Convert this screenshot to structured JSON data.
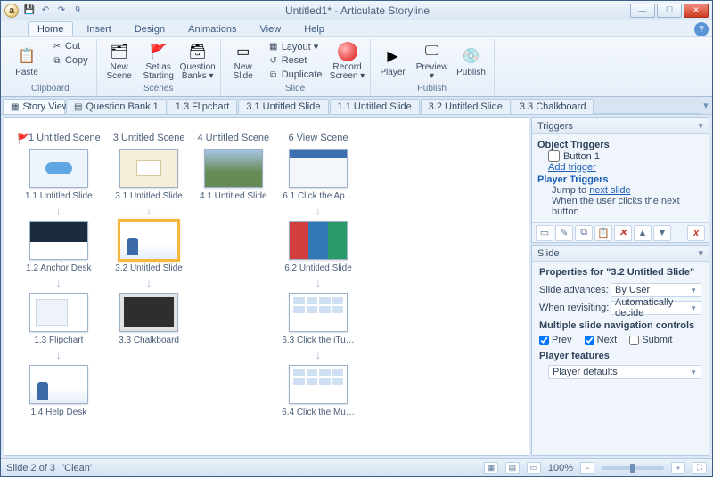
{
  "window": {
    "title": "Untitled1* - Articulate Storyline",
    "app_initial": "a"
  },
  "qat": {
    "save": "💾",
    "undo": "↶",
    "redo": "↷",
    "num": "9"
  },
  "win_buttons": {
    "min": "—",
    "max": "☐",
    "close": "✕"
  },
  "menu": {
    "file": "",
    "tabs": [
      "Home",
      "Insert",
      "Design",
      "Animations",
      "View",
      "Help"
    ],
    "active": "Home"
  },
  "ribbon": {
    "clipboard": {
      "label": "Clipboard",
      "paste": "Paste",
      "cut": "Cut",
      "copy": "Copy"
    },
    "scenes": {
      "label": "Scenes",
      "new_scene": "New\nScene",
      "set_starting": "Set as\nStarting",
      "question_banks": "Question\nBanks ▾"
    },
    "slide": {
      "label": "Slide",
      "new_slide": "New\nSlide",
      "layout": "Layout ▾",
      "reset": "Reset",
      "duplicate": "Duplicate",
      "record": "Record\nScreen ▾"
    },
    "publish": {
      "label": "Publish",
      "player": "Player",
      "preview": "Preview\n▾",
      "publish": "Publish"
    }
  },
  "doc_tabs": [
    {
      "label": "Story View",
      "icon": "▦",
      "active": true
    },
    {
      "label": "Question Bank 1",
      "icon": "▤"
    },
    {
      "label": "1.3 Flipchart"
    },
    {
      "label": "3.1 Untitled Slide"
    },
    {
      "label": "1.1 Untitled Slide"
    },
    {
      "label": "3.2 Untitled Slide"
    },
    {
      "label": "3.3 Chalkboard"
    }
  ],
  "scenes": [
    {
      "title": "1 Untitled Scene",
      "flag": true,
      "slides": [
        {
          "label": "1.1 Untitled Slide",
          "vis": "tv-bubble"
        },
        {
          "label": "1.2 Anchor Desk",
          "vis": "tv-desk"
        },
        {
          "label": "1.3 Flipchart",
          "vis": "tv-flip"
        },
        {
          "label": "1.4 Help Desk",
          "vis": "tv-person"
        }
      ]
    },
    {
      "title": "3 Untitled Scene",
      "slides": [
        {
          "label": "3.1 Untitled Slide",
          "vis": "tv-card"
        },
        {
          "label": "3.2 Untitled Slide",
          "vis": "tv-person",
          "selected": true
        },
        {
          "label": "3.3 Chalkboard",
          "vis": "tv-chalk"
        }
      ]
    },
    {
      "title": "4 Untitled Scene",
      "slides": [
        {
          "label": "4.1 Untitled Slide",
          "vis": "tv-photo"
        }
      ]
    },
    {
      "title": "6 View Scene",
      "slides": [
        {
          "label": "6.1 Click the Ap…",
          "vis": "tv-app"
        },
        {
          "label": "6.2 Untitled Slide",
          "vis": "tv-tabs"
        },
        {
          "label": "6.3 Click the iTu…",
          "vis": "tv-grid"
        },
        {
          "label": "6.4 Click the Mu…",
          "vis": "tv-grid"
        }
      ]
    }
  ],
  "triggers_panel": {
    "title": "Triggers",
    "object_header": "Object Triggers",
    "button1": "Button 1",
    "add_trigger": "Add trigger",
    "player_header": "Player Triggers",
    "jump_prefix": "Jump to ",
    "jump_link": "next slide",
    "jump_condition": "When the user clicks the next button"
  },
  "slide_panel": {
    "title": "Slide",
    "props_for": "Properties for \"3.2 Untitled Slide\"",
    "advances_label": "Slide advances:",
    "advances_value": "By User",
    "revisit_label": "When revisiting:",
    "revisit_value": "Automatically decide",
    "nav_header": "Multiple slide navigation controls",
    "prev": "Prev",
    "next": "Next",
    "submit": "Submit",
    "features_header": "Player features",
    "features_value": "Player defaults"
  },
  "status": {
    "left1": "Slide 2 of 3",
    "left2": "'Clean'",
    "zoom": "100%"
  }
}
